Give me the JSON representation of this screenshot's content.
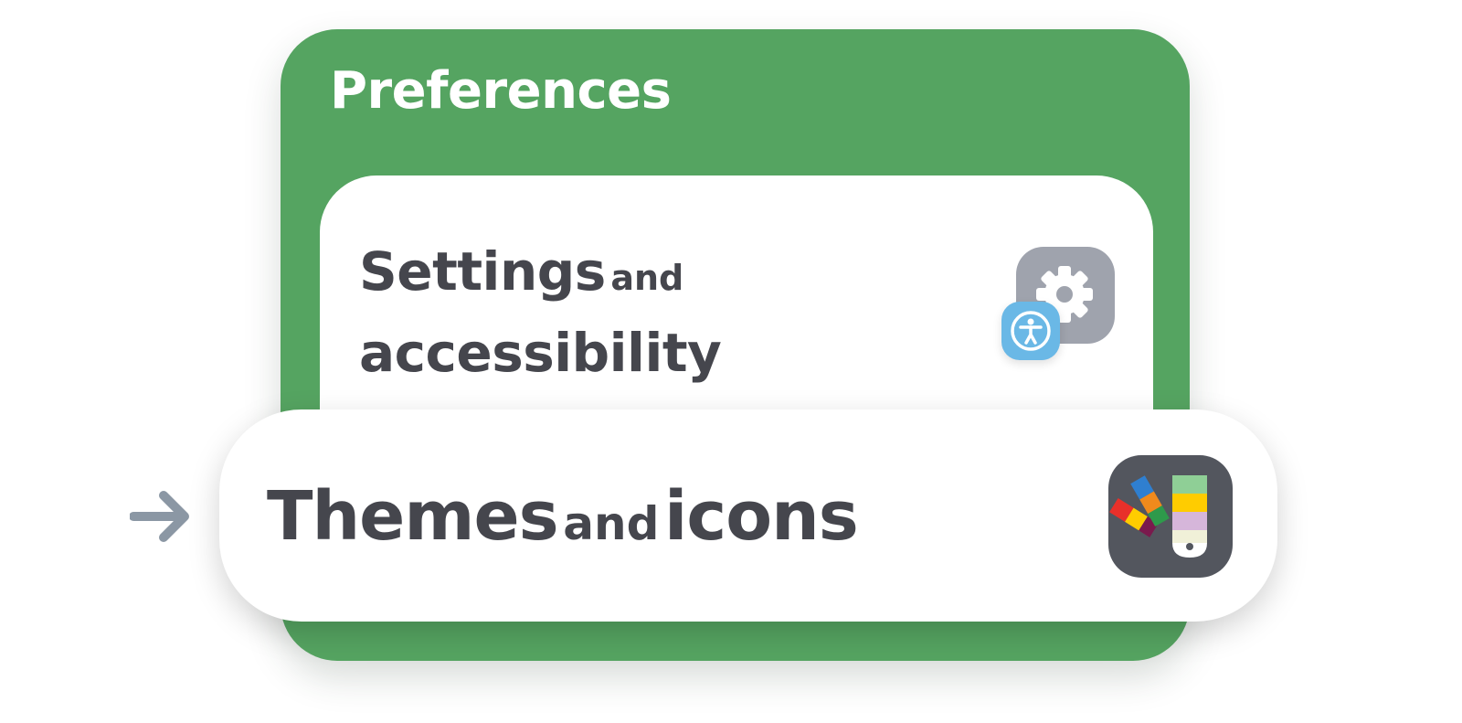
{
  "panel": {
    "title": "Preferences",
    "background_color": "#55a461"
  },
  "settings_item": {
    "word1": "Settings",
    "connector": "and",
    "word2": "accessibility",
    "icon": "gear-icon",
    "badge_icon": "accessibility-icon"
  },
  "themes_item": {
    "word1": "Themes",
    "connector": "and",
    "word2": "icons",
    "icon": "palette-swatch-icon",
    "indicator_icon": "arrow-right-icon"
  }
}
